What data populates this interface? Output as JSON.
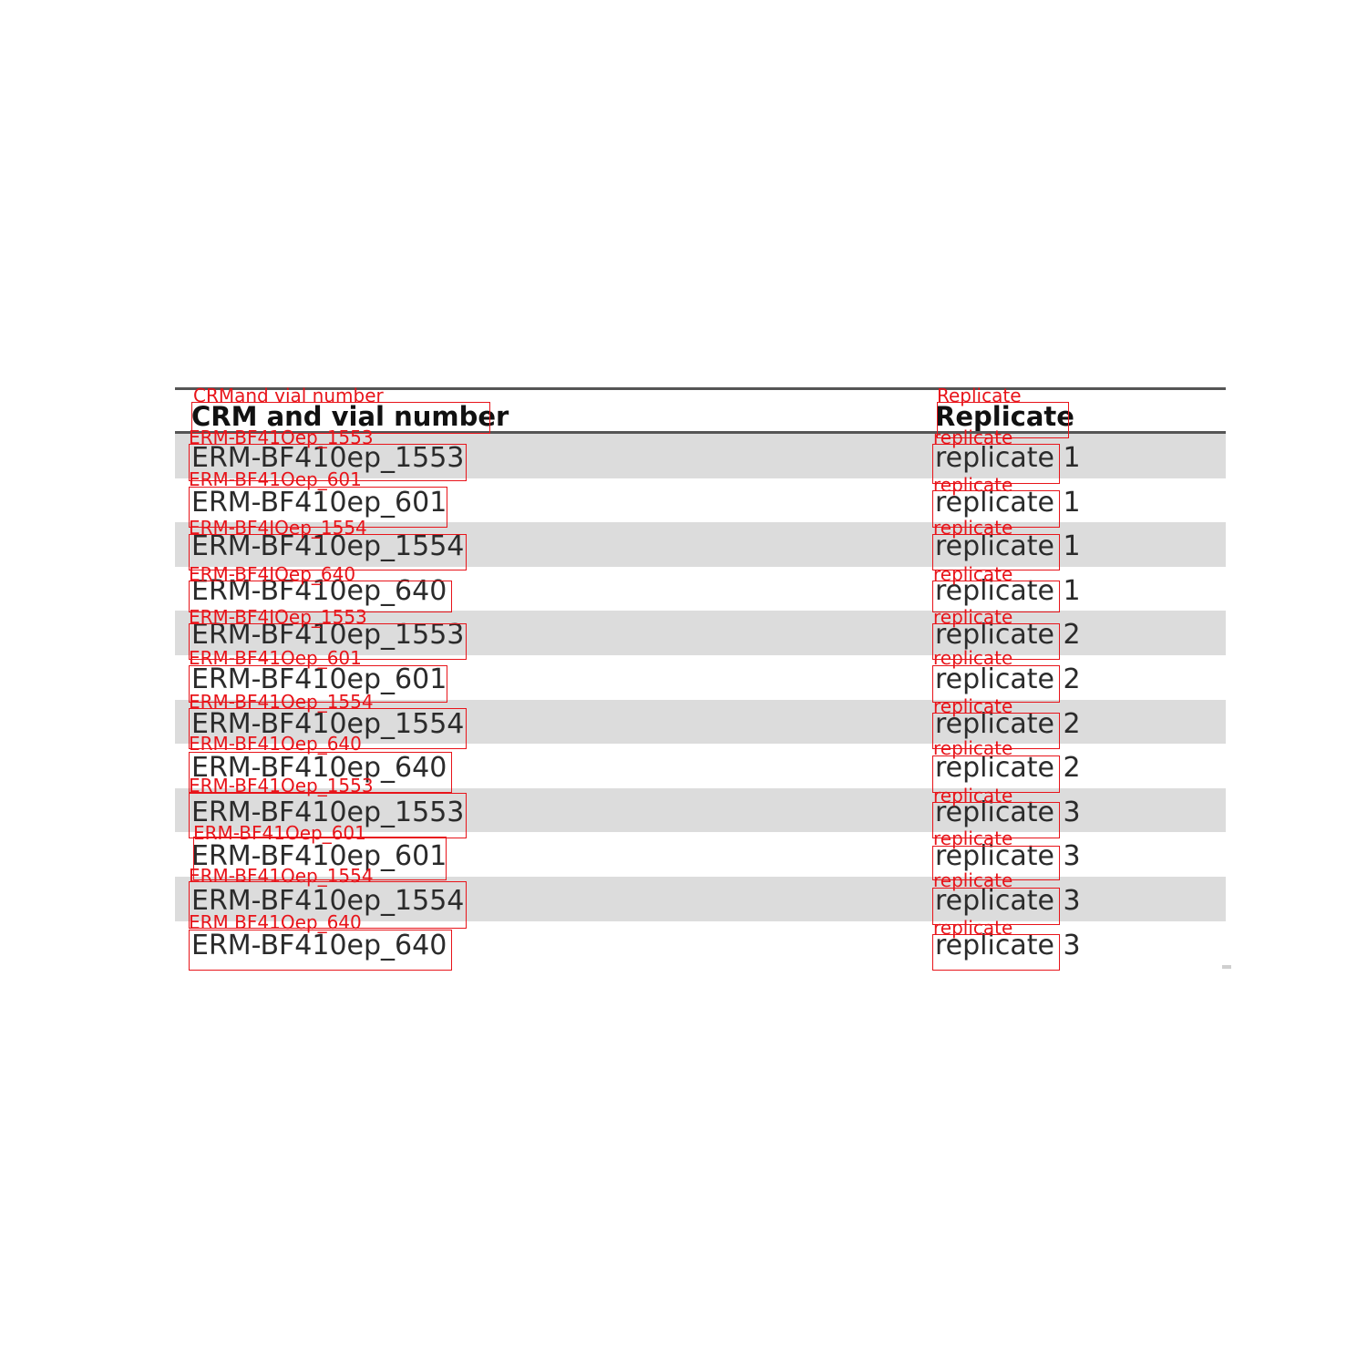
{
  "table": {
    "headers": [
      "CRM and vial number",
      "Replicate"
    ],
    "rows": [
      [
        "ERM-BF410ep_1553",
        "replicate 1"
      ],
      [
        "ERM-BF410ep_601",
        "replicate 1"
      ],
      [
        "ERM-BF410ep_1554",
        "replicate 1"
      ],
      [
        "ERM-BF410ep_640",
        "replicate 1"
      ],
      [
        "ERM-BF410ep_1553",
        "replicate 2"
      ],
      [
        "ERM-BF410ep_601",
        "replicate 2"
      ],
      [
        "ERM-BF410ep_1554",
        "replicate 2"
      ],
      [
        "ERM-BF410ep_640",
        "replicate 2"
      ],
      [
        "ERM-BF410ep_1553",
        "replicate 3"
      ],
      [
        "ERM-BF410ep_601",
        "replicate 3"
      ],
      [
        "ERM-BF410ep_1554",
        "replicate 3"
      ],
      [
        "ERM-BF410ep_640",
        "replicate 3"
      ]
    ],
    "shaded_rows": [
      0,
      2,
      4,
      6,
      8,
      10
    ]
  },
  "annotations": {
    "color": "#e8141a",
    "header_labels": [
      "CRMand vial number",
      "Replicate"
    ],
    "row_labels": [
      [
        "ERM-BF41Oep_1553",
        "replicate"
      ],
      [
        "ERM-BF41Oep_601",
        "replicate"
      ],
      [
        "ERM-BF4IOep_1554",
        "replicate"
      ],
      [
        "ERM-BF4IOep_640",
        "replicate"
      ],
      [
        "ERM-BF4IOep_1553",
        "replicate"
      ],
      [
        "ERM-BF41Oep_601",
        "replicate"
      ],
      [
        "ERM-BF41Oep_1554",
        "replicate"
      ],
      [
        "ERM-BF41Oep_640",
        "replicate"
      ],
      [
        "ERM-BF41Oep_1553",
        "replicate"
      ],
      [
        "ERM-BF41Oep_601",
        "replicate"
      ],
      [
        "ERM-BF41Oep_1554",
        "replicate"
      ],
      [
        "ERM BF41Oep_640",
        "replicate"
      ]
    ]
  }
}
